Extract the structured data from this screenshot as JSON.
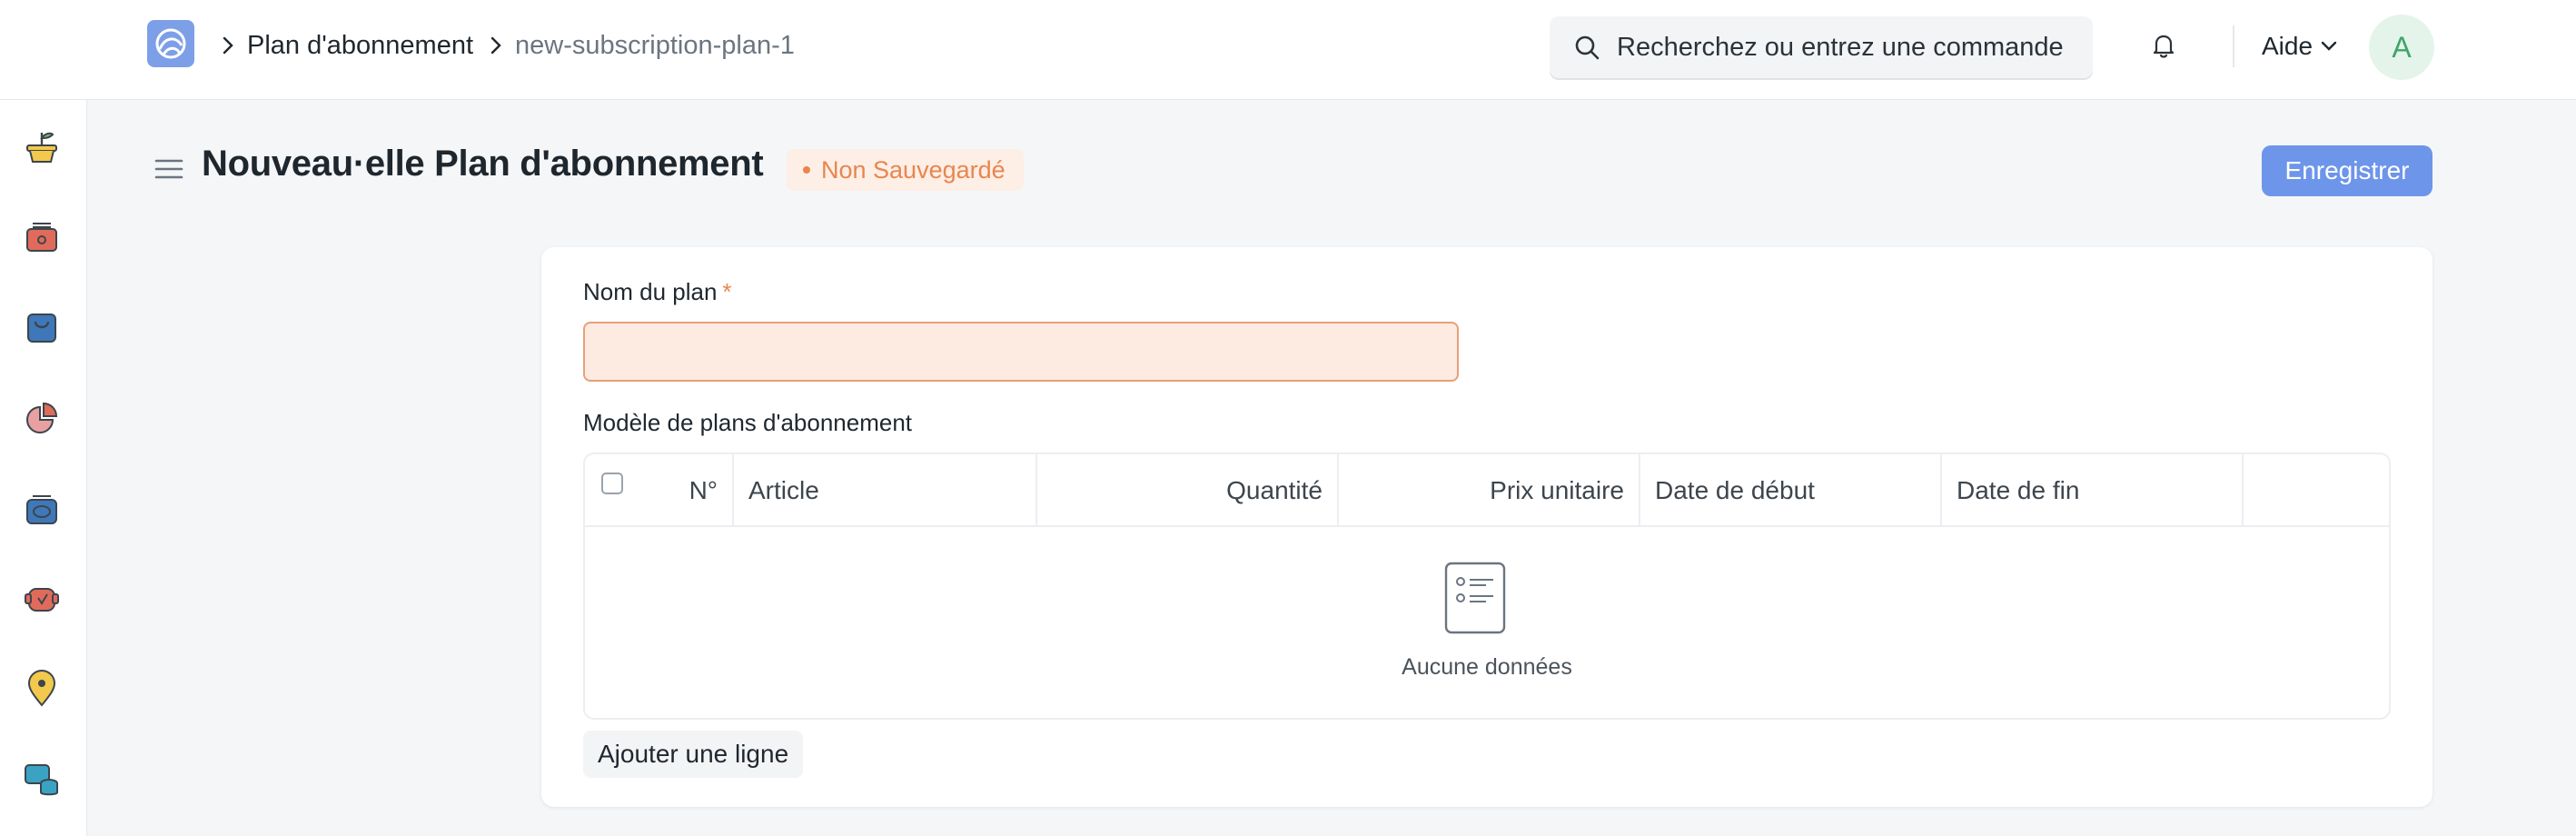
{
  "navbar": {
    "breadcrumb": {
      "doctype": "Plan d'abonnement",
      "record": "new-subscription-plan-1"
    },
    "search": {
      "placeholder": "Recherchez ou entrez une commande"
    },
    "help_label": "Aide",
    "avatar_initial": "A"
  },
  "sidebar": {
    "icons": [
      "plant-icon",
      "cash-register-icon",
      "shopping-bag-icon",
      "pie-chart-icon",
      "invoice-icon",
      "support-icon",
      "map-pin-icon",
      "assets-icon"
    ]
  },
  "page": {
    "title": "Nouveau·elle Plan d'abonnement",
    "status": "Non Sauvegardé",
    "save_label": "Enregistrer"
  },
  "form": {
    "plan_name_label": "Nom du plan",
    "required_mark": "*",
    "plan_name_value": "",
    "table_label": "Modèle de plans d'abonnement",
    "table": {
      "columns": [
        "N°",
        "Article",
        "Quantité",
        "Prix unitaire",
        "Date de début",
        "Date de fin"
      ],
      "rows": [],
      "empty_text": "Aucune données"
    },
    "add_row_label": "Ajouter une ligne"
  },
  "colors": {
    "accent": "#6d95ea",
    "warning": "#e8864d",
    "avatar_bg": "#e4f4ea",
    "avatar_fg": "#3fa56b"
  }
}
